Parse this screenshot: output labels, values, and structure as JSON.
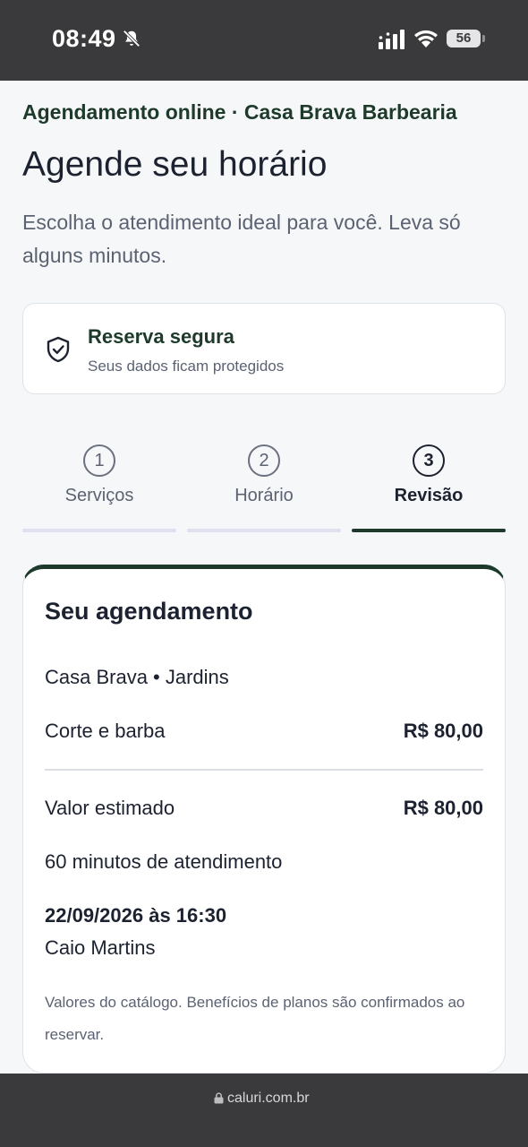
{
  "status": {
    "time": "08:49",
    "battery": "56"
  },
  "header": {
    "eyebrow": "Agendamento online · Casa Brava Barbearia",
    "title": "Agende seu horário",
    "subtitle": "Escolha o atendimento ideal para você. Leva só alguns minutos."
  },
  "secure": {
    "title": "Reserva segura",
    "subtitle": "Seus dados ficam protegidos"
  },
  "steps": [
    {
      "number": "1",
      "label": "Serviços"
    },
    {
      "number": "2",
      "label": "Horário"
    },
    {
      "number": "3",
      "label": "Revisão"
    }
  ],
  "active_step": 3,
  "summary": {
    "title": "Seu agendamento",
    "location": "Casa Brava • Jardins",
    "service_name": "Corte e barba",
    "service_price": "R$ 80,00",
    "estimate_label": "Valor estimado",
    "estimate_value": "R$ 80,00",
    "duration": "60 minutos de atendimento",
    "datetime": "22/09/2026 às 16:30",
    "professional": "Caio Martins",
    "note": "Valores do catálogo. Benefícios de planos são confirmados ao reservar."
  },
  "browser": {
    "url": "caluri.com.br"
  },
  "colors": {
    "brand": "#1d3a2a",
    "text": "#1c2230",
    "muted": "#5b6272",
    "inactive_bar": "#dfe1ee"
  },
  "icons": {
    "bell": "bell-slash-icon",
    "signal": "signal-icon",
    "wifi": "wifi-icon",
    "shield": "shield-check-icon",
    "lock": "lock-icon"
  }
}
